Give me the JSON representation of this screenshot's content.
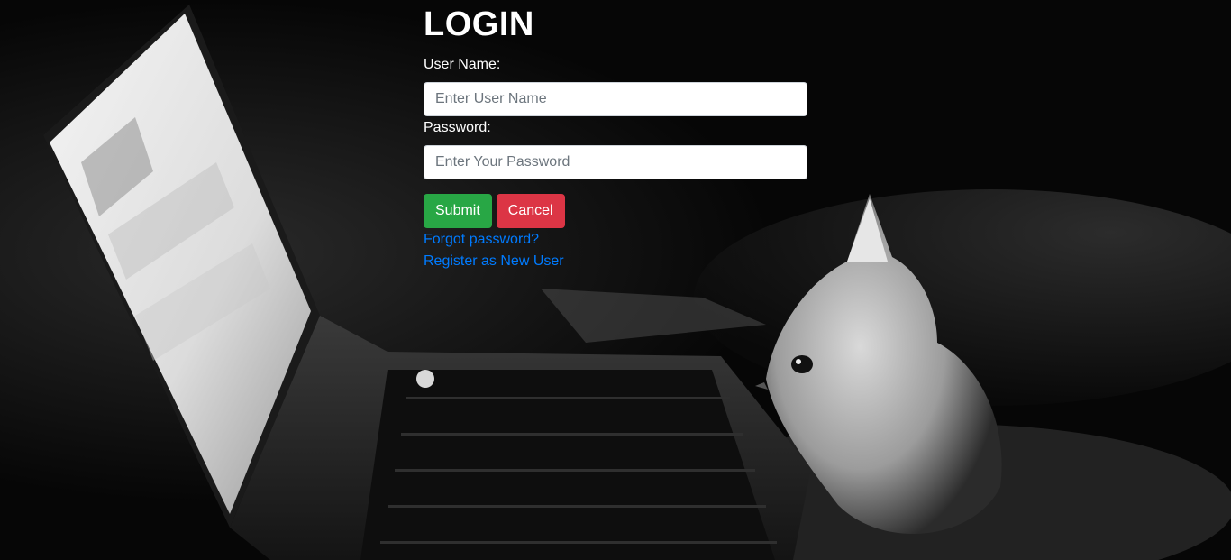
{
  "login": {
    "title": "LOGIN",
    "username": {
      "label": "User Name:",
      "placeholder": "Enter User Name",
      "value": ""
    },
    "password": {
      "label": "Password:",
      "placeholder": "Enter Your Password",
      "value": ""
    },
    "buttons": {
      "submit": "Submit",
      "cancel": "Cancel"
    },
    "links": {
      "forgot_password": "Forgot password?",
      "register": "Register as New User"
    }
  },
  "colors": {
    "submit": "#28a745",
    "cancel": "#dc3545",
    "link": "#007bff",
    "text": "#ffffff"
  },
  "background": {
    "icon": "laptop-and-kitten-photo"
  }
}
